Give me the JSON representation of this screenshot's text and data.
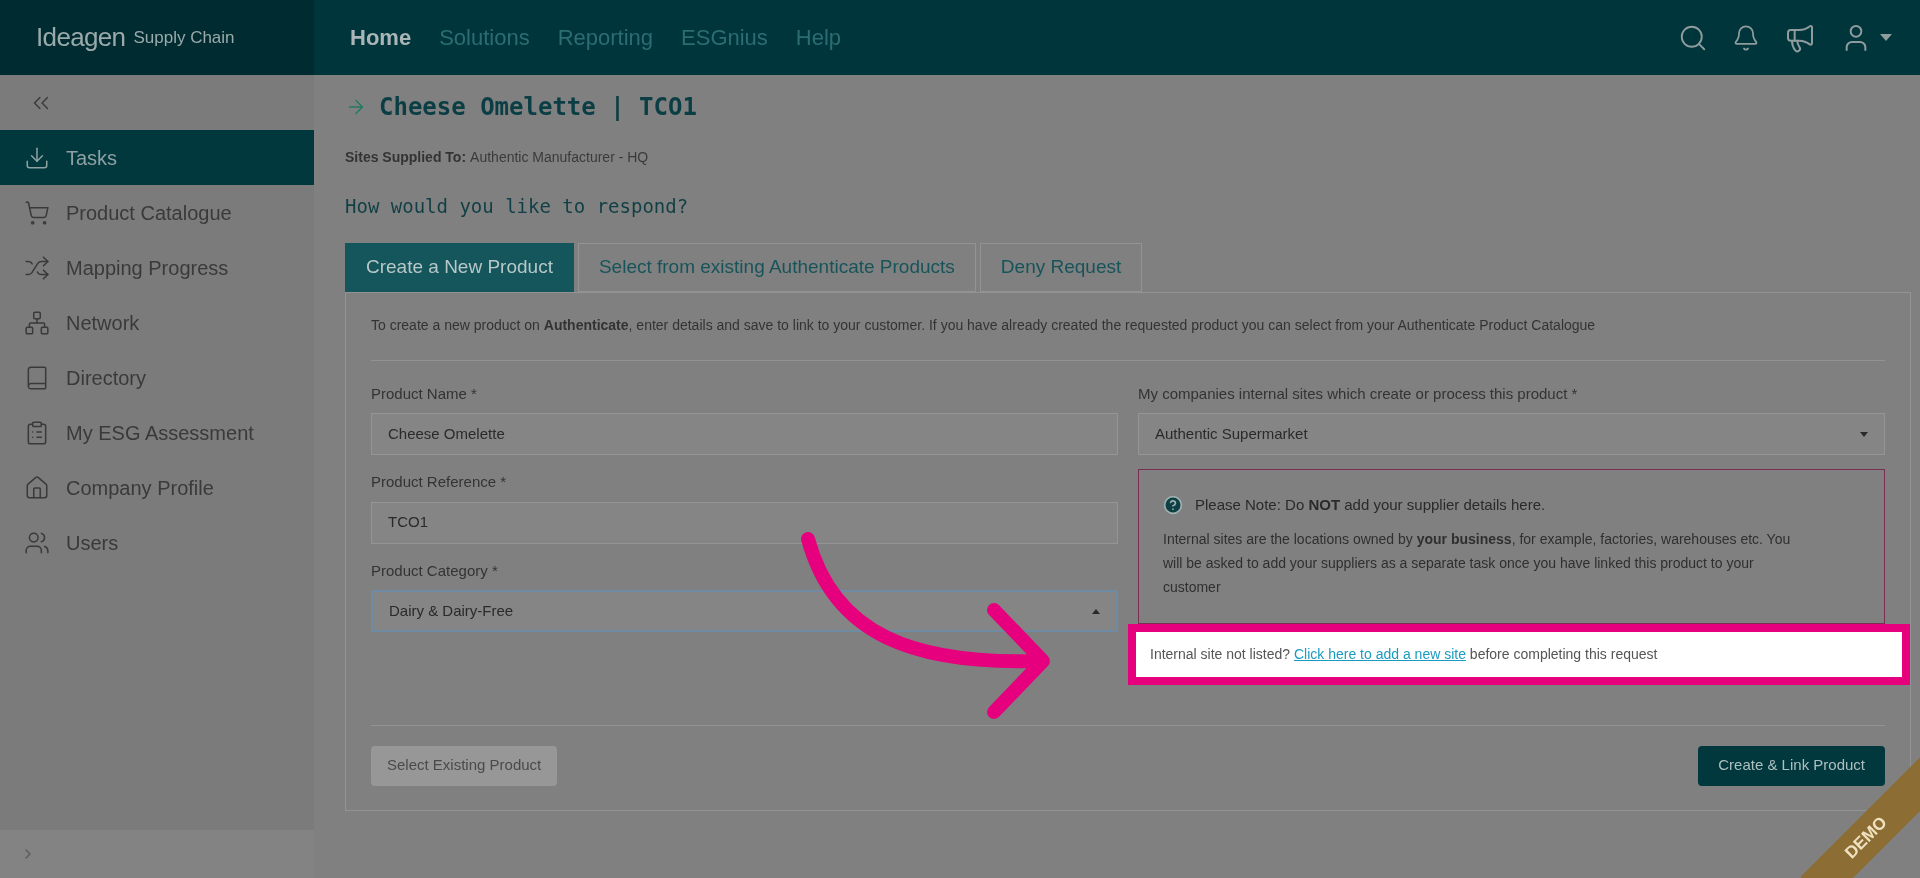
{
  "header": {
    "logo": "Ideagen",
    "logo_sub": "Supply Chain",
    "nav": [
      {
        "label": "Home",
        "selected": true
      },
      {
        "label": "Solutions",
        "selected": false
      },
      {
        "label": "Reporting",
        "selected": false
      },
      {
        "label": "ESGnius",
        "selected": false
      },
      {
        "label": "Help",
        "selected": false
      }
    ]
  },
  "sidebar": {
    "items": [
      {
        "label": "Tasks",
        "selected": true
      },
      {
        "label": "Product Catalogue",
        "selected": false
      },
      {
        "label": "Mapping Progress",
        "selected": false
      },
      {
        "label": "Network",
        "selected": false
      },
      {
        "label": "Directory",
        "selected": false
      },
      {
        "label": "My ESG Assessment",
        "selected": false
      },
      {
        "label": "Company Profile",
        "selected": false
      },
      {
        "label": "Users",
        "selected": false
      }
    ]
  },
  "page": {
    "title": "Cheese Omelette | TCO1",
    "sites_label": "Sites Supplied To:",
    "sites_value": "Authentic Manufacturer - HQ",
    "question": "How would you like to respond?"
  },
  "tabs": [
    {
      "label": "Create a New Product",
      "selected": true
    },
    {
      "label": "Select from existing Authenticate Products",
      "selected": false
    },
    {
      "label": "Deny Request",
      "selected": false
    }
  ],
  "form": {
    "intro": "To create a new product on **Authenticate**, enter details and save to link to your customer. If you have already created the requested product you can select from your Authenticate Product Catalogue",
    "fields": [
      {
        "label": "Product Name *",
        "value": "Cheese Omelette",
        "kind": "text",
        "focused": false
      },
      {
        "label": "Product Reference *",
        "value": "TCO1",
        "kind": "text",
        "focused": false
      },
      {
        "label": "Product Category *",
        "value": "Dairy & Dairy-Free",
        "kind": "select",
        "focused": true
      }
    ],
    "sites_field": {
      "label": "My companies internal sites which create or process this product *",
      "value": "Authentic Supermarket"
    },
    "note": {
      "title": "Please Note: Do **NOT** add your supplier details here.",
      "body": "Internal sites are the locations owned by **your business**, for example, factories, warehouses etc. You will be asked to add your suppliers as a separate task once you have linked this product to your customer"
    },
    "site_prompt": {
      "before": "Internal site not listed?",
      "link": "Click here to add a new site",
      "after": "before completing this request"
    },
    "secondary_button": "Select Existing Product",
    "primary_button": "Create & Link Product"
  },
  "demo_badge": "DEMO"
}
